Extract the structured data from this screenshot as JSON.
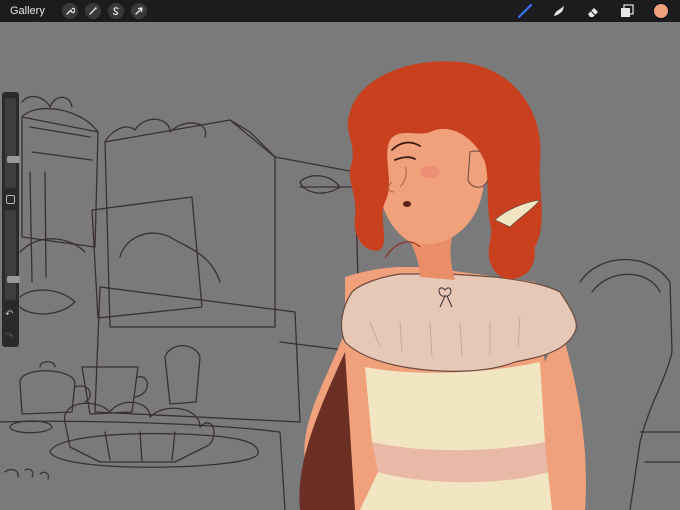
{
  "toolbar": {
    "gallery_label": "Gallery",
    "left_tools": [
      {
        "name": "wrench-icon"
      },
      {
        "name": "adjustments-magic-wand-icon"
      },
      {
        "name": "selection-s-icon"
      },
      {
        "name": "transform-arrow-icon"
      }
    ],
    "right_tools": [
      {
        "name": "brush-icon",
        "active": true
      },
      {
        "name": "smudge-icon",
        "active": false
      },
      {
        "name": "eraser-icon",
        "active": false
      },
      {
        "name": "layers-icon",
        "active": false
      }
    ],
    "active_color": "#f0a07a",
    "accent_color": "#2f7bff"
  },
  "sidebar": {
    "brush_size_level": 0.3,
    "opacity_level": 0.2,
    "modify_icon": "square-modify-icon",
    "undo_icon": "undo-arrow-icon",
    "redo_icon": "redo-arrow-icon"
  },
  "canvas": {
    "background_color": "#7a7a7a",
    "hair_color": "#c8401e",
    "skin_color": "#f0a07a",
    "dress_top_color": "#e7c8b6",
    "dress_bottom_color": "#f2e6c2",
    "sash_color": "#e8b9a6",
    "arm_shadow_color": "#6b2f24",
    "sketch_line_color": "#3a3030"
  }
}
